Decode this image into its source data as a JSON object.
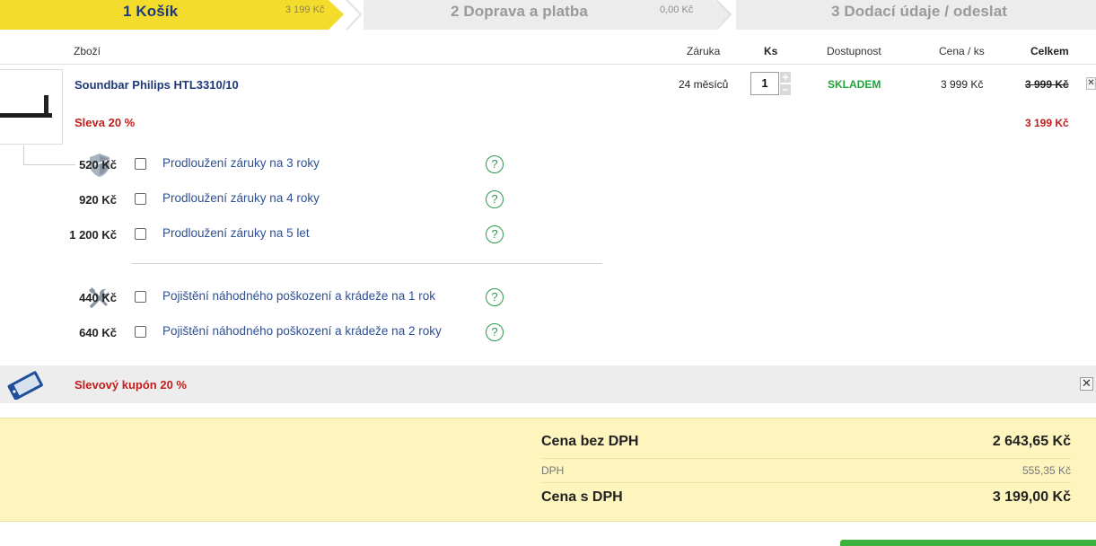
{
  "steps": [
    {
      "label": "1 Košík",
      "price": "3 199 Kč"
    },
    {
      "label": "2 Doprava a platba",
      "price": "0,00  Kč"
    },
    {
      "label": "3 Dodací údaje / odeslat",
      "price": ""
    }
  ],
  "table_header": {
    "product": "Zboží",
    "warranty": "Záruka",
    "qty": "Ks",
    "availability": "Dostupnost",
    "unit_price": "Cena / ks",
    "total": "Celkem"
  },
  "product": {
    "name": "Soundbar Philips HTL3310/10",
    "warranty": "24 měsíců",
    "qty": "1",
    "availability": "SKLADEM",
    "unit_price": "3 999 Kč",
    "old_total": "3 999 Kč",
    "discount_label": "Sleva 20 %",
    "new_total": "3 199 Kč"
  },
  "warranty_services": [
    {
      "label": "Prodloužení záruky na 3 roky",
      "price": "520 Kč",
      "checked": false
    },
    {
      "label": "Prodloužení záruky na 4 roky",
      "price": "920 Kč",
      "checked": false
    },
    {
      "label": "Prodloužení záruky na 5 let",
      "price": "1 200 Kč",
      "checked": false
    }
  ],
  "insurance_services": [
    {
      "label": "Pojištění náhodného poškození a krádeže na 1 rok",
      "price": "440 Kč",
      "checked": false
    },
    {
      "label": "Pojištění náhodného poškození a krádeže na 2 roky",
      "price": "640 Kč",
      "checked": false
    }
  ],
  "help_glyph": "?",
  "coupon": {
    "label": "Slevový kupón 20 %"
  },
  "totals": {
    "net_label": "Cena bez DPH",
    "net_value": "2 643,65 Kč",
    "vat_label": "DPH",
    "vat_value": "555,35 Kč",
    "gross_label": "Cena s DPH",
    "gross_value": "3 199,00 Kč"
  },
  "icons": {
    "warranty": "shield-icon",
    "insurance": "tools-icon",
    "coupon": "coupon-ticket-icon",
    "remove": "close-icon"
  },
  "colors": {
    "active_step": "#f4dc2c",
    "inactive_step": "#ececec",
    "brand_blue": "#1f3a7a",
    "discount_red": "#c31d1d",
    "stock_green": "#22a33a",
    "totals_bg": "#fdf4be"
  }
}
